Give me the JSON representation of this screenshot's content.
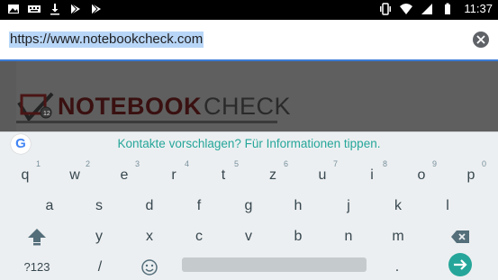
{
  "status_bar": {
    "left_icons": [
      "image-icon",
      "keyboard-icon",
      "download-icon",
      "play-store-icon",
      "play-store-icon"
    ],
    "right_icons": [
      "vibrate-icon",
      "wifi-icon",
      "signal-icon",
      "battery-icon"
    ],
    "time": "11:37"
  },
  "url_bar": {
    "url": "https://www.notebookcheck.com",
    "clear_icon": "close-icon"
  },
  "page": {
    "logo_part1": "NOTEBOOK",
    "logo_part2": "CHECK"
  },
  "suggestion": {
    "text": "Kontakte vorschlagen? Für Informationen tippen."
  },
  "keyboard": {
    "row1": [
      {
        "k": "q",
        "h": "1"
      },
      {
        "k": "w",
        "h": "2"
      },
      {
        "k": "e",
        "h": "3"
      },
      {
        "k": "r",
        "h": "4"
      },
      {
        "k": "t",
        "h": "5"
      },
      {
        "k": "z",
        "h": "6"
      },
      {
        "k": "u",
        "h": "7"
      },
      {
        "k": "i",
        "h": "8"
      },
      {
        "k": "o",
        "h": "9"
      },
      {
        "k": "p",
        "h": "0"
      }
    ],
    "row2": [
      "a",
      "s",
      "d",
      "f",
      "g",
      "h",
      "j",
      "k",
      "l"
    ],
    "row3": [
      "y",
      "x",
      "c",
      "v",
      "b",
      "n",
      "m"
    ],
    "symbols_label": "?123",
    "slash": "/",
    "period": "."
  }
}
